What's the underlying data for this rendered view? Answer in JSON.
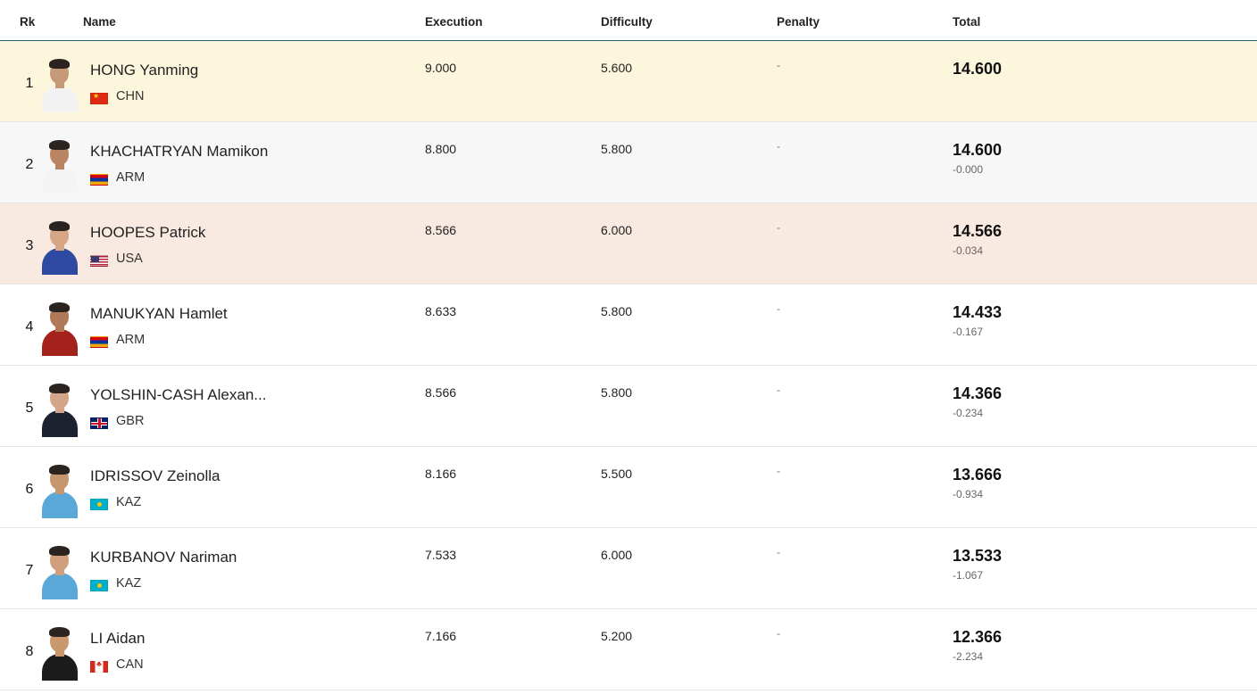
{
  "header": {
    "rk": "Rk",
    "name": "Name",
    "execution": "Execution",
    "difficulty": "Difficulty",
    "penalty": "Penalty",
    "total": "Total"
  },
  "rows": [
    {
      "rank": "1",
      "name": "HONG Yanming",
      "noc": "CHN",
      "execution": "9.000",
      "difficulty": "5.600",
      "penalty": "-",
      "total": "14.600",
      "behind": "",
      "flag": "CHN",
      "highlight": "gold",
      "uniform": "#f2f2f2",
      "skin": "#c59a78"
    },
    {
      "rank": "2",
      "name": "KHACHATRYAN Mamikon",
      "noc": "ARM",
      "execution": "8.800",
      "difficulty": "5.800",
      "penalty": "-",
      "total": "14.600",
      "behind": "-0.000",
      "flag": "ARM",
      "highlight": "silver",
      "uniform": "#f4f4f4",
      "skin": "#b98463"
    },
    {
      "rank": "3",
      "name": "HOOPES Patrick",
      "noc": "USA",
      "execution": "8.566",
      "difficulty": "6.000",
      "penalty": "-",
      "total": "14.566",
      "behind": "-0.034",
      "flag": "USA",
      "highlight": "bronze",
      "uniform": "#2d4aa0",
      "skin": "#d6a687"
    },
    {
      "rank": "4",
      "name": "MANUKYAN Hamlet",
      "noc": "ARM",
      "execution": "8.633",
      "difficulty": "5.800",
      "penalty": "-",
      "total": "14.433",
      "behind": "-0.167",
      "flag": "ARM",
      "highlight": "none",
      "uniform": "#a3231c",
      "skin": "#b07a5a"
    },
    {
      "rank": "5",
      "name": "YOLSHIN-CASH Alexan...",
      "noc": "GBR",
      "execution": "8.566",
      "difficulty": "5.800",
      "penalty": "-",
      "total": "14.366",
      "behind": "-0.234",
      "flag": "GBR",
      "highlight": "none",
      "uniform": "#1d2230",
      "skin": "#d4a588"
    },
    {
      "rank": "6",
      "name": "IDRISSOV Zeinolla",
      "noc": "KAZ",
      "execution": "8.166",
      "difficulty": "5.500",
      "penalty": "-",
      "total": "13.666",
      "behind": "-0.934",
      "flag": "KAZ",
      "highlight": "none",
      "uniform": "#5aa8d8",
      "skin": "#c6966f"
    },
    {
      "rank": "7",
      "name": "KURBANOV Nariman",
      "noc": "KAZ",
      "execution": "7.533",
      "difficulty": "6.000",
      "penalty": "-",
      "total": "13.533",
      "behind": "-1.067",
      "flag": "KAZ",
      "highlight": "none",
      "uniform": "#5aa8d8",
      "skin": "#d0a07e"
    },
    {
      "rank": "8",
      "name": "LI Aidan",
      "noc": "CAN",
      "execution": "7.166",
      "difficulty": "5.200",
      "penalty": "-",
      "total": "12.366",
      "behind": "-2.234",
      "flag": "CAN",
      "highlight": "none",
      "uniform": "#1b1b1b",
      "skin": "#c9986f"
    }
  ]
}
